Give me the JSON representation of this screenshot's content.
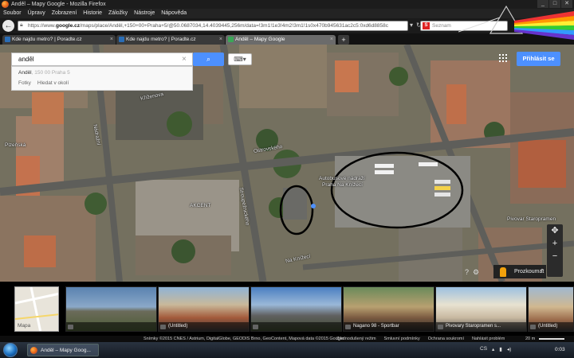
{
  "window": {
    "title": "Anděl – Mapy Google - Mozilla Firefox"
  },
  "menu": [
    "Soubor",
    "Úpravy",
    "Zobrazení",
    "Historie",
    "Záložky",
    "Nástroje",
    "Nápověda"
  ],
  "navbar": {
    "url_prefix": "https://www.",
    "url_domain": "google.cz",
    "url_rest": "/maps/place/Anděl,+150+00+Praha+5/@50.0687034,14.4039445,256m/data=!3m1!1e3!4m2!3m1!1s0x470b945631ac2c5:0xd6d8858c",
    "search_engine_label": "S",
    "search_placeholder": "Seznam"
  },
  "tabs": [
    {
      "label": "Kde najdu metro? | Poradte.cz",
      "active": false
    },
    {
      "label": "Kde najdu metro? | Poradte.cz",
      "active": false
    },
    {
      "label": "Anděl – Mapy Google",
      "active": true
    }
  ],
  "maps": {
    "search_value": "anděl",
    "search_clear_symbol": "×",
    "suggestion_main": "Anděl",
    "suggestion_detail": ", 150 00 Praha 5",
    "suggestion_links": [
      "Fotky",
      "Hledat v okolí"
    ],
    "sign_in_label": "Přihlásit se",
    "explore_label": "Prozkoumat",
    "explore_chevron": "⌃",
    "zoom_in": "+",
    "zoom_out": "−",
    "help_icon_text": "?",
    "settings_icon_text": "⚙",
    "street_labels": [
      {
        "text": "Kříženova"
      },
      {
        "text": "Nádražní"
      },
      {
        "text": "Ostrovského"
      },
      {
        "text": "Stroupežnického"
      },
      {
        "text": "Na Knížecí"
      },
      {
        "text": "Autobusové nádraží"
      },
      {
        "text": "Praha Na Knížecí"
      },
      {
        "text": "AKCENT"
      },
      {
        "text": "Pivovar Staropramen"
      },
      {
        "text": "Plzeňská"
      }
    ]
  },
  "photo_strip": {
    "minimap_label": "Mapa",
    "captions": [
      "",
      "(Untitled)",
      "",
      "Nagano 98 - Sportbar",
      "Pivovary Staropramen s...",
      "(Untitled)"
    ]
  },
  "footer": {
    "attribution": "Snímky ©2015 CNES / Astrium, DigitalGlobe, GEODIS Brno, GeoContent, Mapová data ©2015 Google",
    "links": [
      "Zjednodušený režim",
      "Smluvní podmínky",
      "Ochrana soukromí",
      "Nahlásit problém"
    ],
    "scale": "20 m"
  },
  "taskbar": {
    "task_label": "Anděl – Mapy Goog...",
    "lang": "CS",
    "clock": "0:03"
  },
  "colors": {
    "accent_blue": "#4d90fe",
    "pegman": "#f2a10c"
  }
}
